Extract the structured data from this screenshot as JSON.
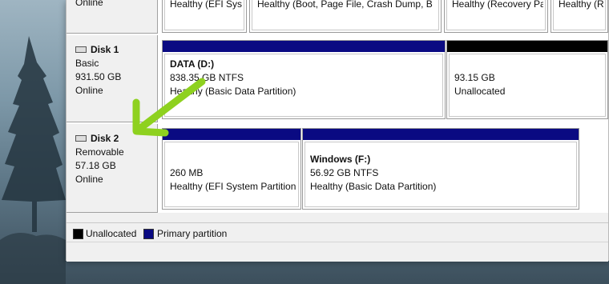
{
  "disks": [
    {
      "status": "Online",
      "partitions": [
        {
          "l1": "Healthy (EFI Syst"
        },
        {
          "l1": "Healthy (Boot, Page File, Crash Dump, B"
        },
        {
          "l1": "Healthy (Recovery Pa"
        },
        {
          "l1": "Healthy (Re"
        }
      ]
    },
    {
      "name": "Disk 1",
      "type": "Basic",
      "size": "931.50 GB",
      "status": "Online",
      "partitions": [
        {
          "name": "DATA  (D:)",
          "l2": "838.35 GB NTFS",
          "l3": "Healthy (Basic Data Partition)"
        },
        {
          "l2": "93.15 GB",
          "l3": "Unallocated"
        }
      ]
    },
    {
      "name": "Disk 2",
      "type": "Removable",
      "size": "57.18 GB",
      "status": "Online",
      "partitions": [
        {
          "l2": "260 MB",
          "l3": "Healthy (EFI System Partition"
        },
        {
          "name": "Windows  (F:)",
          "l2": "56.92 GB NTFS",
          "l3": "Healthy (Basic Data Partition)"
        }
      ]
    }
  ],
  "legend": {
    "unallocated": "Unallocated",
    "primary": "Primary partition"
  },
  "colors": {
    "primary": "#0a0a82",
    "unallocated": "#000000",
    "arrow": "#8ed11f"
  },
  "annotation": "green-arrow-icon"
}
